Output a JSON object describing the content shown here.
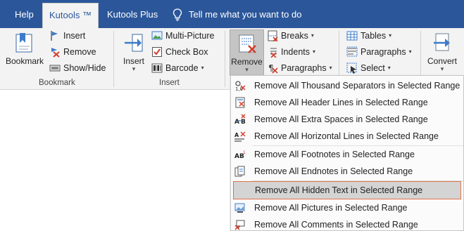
{
  "tabs": {
    "help": "Help",
    "kutools": "Kutools ™",
    "kutools_plus": "Kutools Plus",
    "tell_me": "Tell me what you want to do"
  },
  "ribbon": {
    "bookmark_group": {
      "label": "Bookmark",
      "big_button": "Bookmark",
      "insert": "Insert",
      "remove": "Remove",
      "show_hide": "Show/Hide"
    },
    "insert_group": {
      "label": "Insert",
      "big_button": "Insert",
      "multi_picture": "Multi-Picture",
      "check_box": "Check Box",
      "barcode": "Barcode"
    },
    "remove_group": {
      "big_button": "Remove",
      "breaks": "Breaks",
      "indents": "Indents",
      "paragraphs": "Paragraphs"
    },
    "select_group": {
      "tables": "Tables",
      "paragraphs": "Paragraphs",
      "select": "Select"
    },
    "convert_group": {
      "big_button": "Convert"
    }
  },
  "menu": {
    "items": [
      {
        "label": "Remove All Thousand Separators in Selected Range",
        "icon": "thousand-separators-icon"
      },
      {
        "label": "Remove All Header Lines in Selected Range",
        "icon": "header-lines-icon"
      },
      {
        "label": "Remove All Extra Spaces in Selected Range",
        "icon": "extra-spaces-icon"
      },
      {
        "label": "Remove All Horizontal Lines in Selected Range",
        "icon": "horizontal-lines-icon"
      },
      {
        "label": "Remove All Footnotes in Selected Range",
        "icon": "footnotes-icon"
      },
      {
        "label": "Remove All Endnotes in Selected Range",
        "icon": "endnotes-icon"
      },
      {
        "label": "Remove All Hidden Text in Selected Range",
        "icon": "hidden-text-icon"
      },
      {
        "label": "Remove All Pictures in Selected Range",
        "icon": "pictures-icon"
      },
      {
        "label": "Remove All Comments in Selected Range",
        "icon": "comments-icon"
      }
    ]
  },
  "colors": {
    "tab_bar": "#2b579a",
    "ribbon_bg": "#f3f3f3",
    "highlight_border": "#e0704a"
  }
}
